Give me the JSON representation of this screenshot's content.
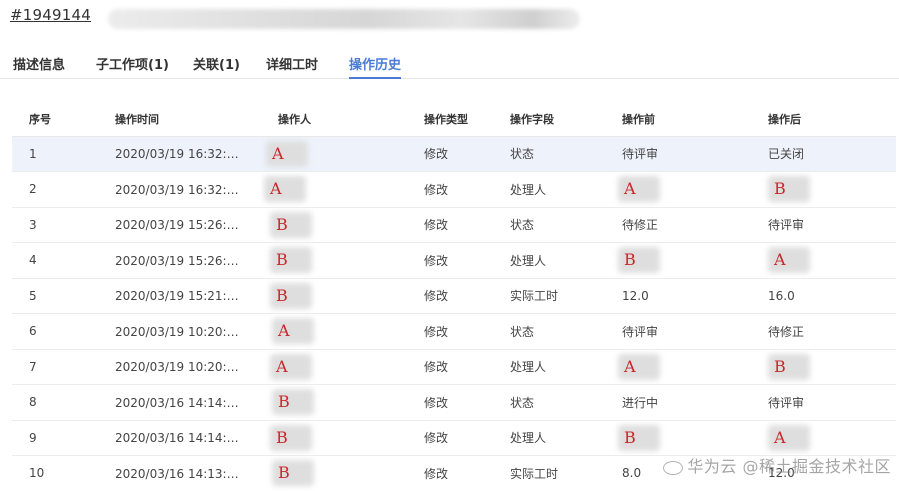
{
  "header": {
    "ticket_id": "#1949144"
  },
  "tabs": [
    {
      "label": "描述信息",
      "active": false
    },
    {
      "label": "子工作项(1)",
      "active": false
    },
    {
      "label": "关联(1)",
      "active": false
    },
    {
      "label": "详细工时",
      "active": false
    },
    {
      "label": "操作历史",
      "active": true
    }
  ],
  "table": {
    "columns": [
      "序号",
      "操作时间",
      "操作人",
      "操作类型",
      "操作字段",
      "操作前",
      "操作后"
    ],
    "rows": [
      {
        "no": "1",
        "time": "2020/03/19 16:32:1...",
        "operator": "A",
        "type": "修改",
        "field": "状态",
        "before": "待评审",
        "after": "已关闭",
        "before_redacted": false,
        "after_redacted": false
      },
      {
        "no": "2",
        "time": "2020/03/19 16:32:1...",
        "operator": "A",
        "type": "修改",
        "field": "处理人",
        "before": "A",
        "after": "B",
        "before_redacted": true,
        "after_redacted": true
      },
      {
        "no": "3",
        "time": "2020/03/19 15:26:4...",
        "operator": "B",
        "type": "修改",
        "field": "状态",
        "before": "待修正",
        "after": "待评审",
        "before_redacted": false,
        "after_redacted": false
      },
      {
        "no": "4",
        "time": "2020/03/19 15:26:4...",
        "operator": "B",
        "type": "修改",
        "field": "处理人",
        "before": "B",
        "after": "A",
        "before_redacted": true,
        "after_redacted": true
      },
      {
        "no": "5",
        "time": "2020/03/19 15:21:1...",
        "operator": "B",
        "type": "修改",
        "field": "实际工时",
        "before": "12.0",
        "after": "16.0",
        "before_redacted": false,
        "after_redacted": false
      },
      {
        "no": "6",
        "time": "2020/03/19 10:20:0...",
        "operator": "A",
        "type": "修改",
        "field": "状态",
        "before": "待评审",
        "after": "待修正",
        "before_redacted": false,
        "after_redacted": false
      },
      {
        "no": "7",
        "time": "2020/03/19 10:20:0...",
        "operator": "A",
        "type": "修改",
        "field": "处理人",
        "before": "A",
        "after": "B",
        "before_redacted": true,
        "after_redacted": true
      },
      {
        "no": "8",
        "time": "2020/03/16 14:14:4...",
        "operator": "B",
        "type": "修改",
        "field": "状态",
        "before": "进行中",
        "after": "待评审",
        "before_redacted": false,
        "after_redacted": false
      },
      {
        "no": "9",
        "time": "2020/03/16 14:14:4...",
        "operator": "B",
        "type": "修改",
        "field": "处理人",
        "before": "B",
        "after": "A",
        "before_redacted": true,
        "after_redacted": true
      },
      {
        "no": "10",
        "time": "2020/03/16 14:13:1...",
        "operator": "B",
        "type": "修改",
        "field": "实际工时",
        "before": "8.0",
        "after": "12.0",
        "before_redacted": false,
        "after_redacted": false
      }
    ]
  },
  "watermark": {
    "text": "华为云 @稀土掘金技术社区"
  },
  "colors": {
    "accent": "#4a7bd6",
    "highlight_row": "#eef3fb",
    "redaction_letter": "#c8282c"
  }
}
